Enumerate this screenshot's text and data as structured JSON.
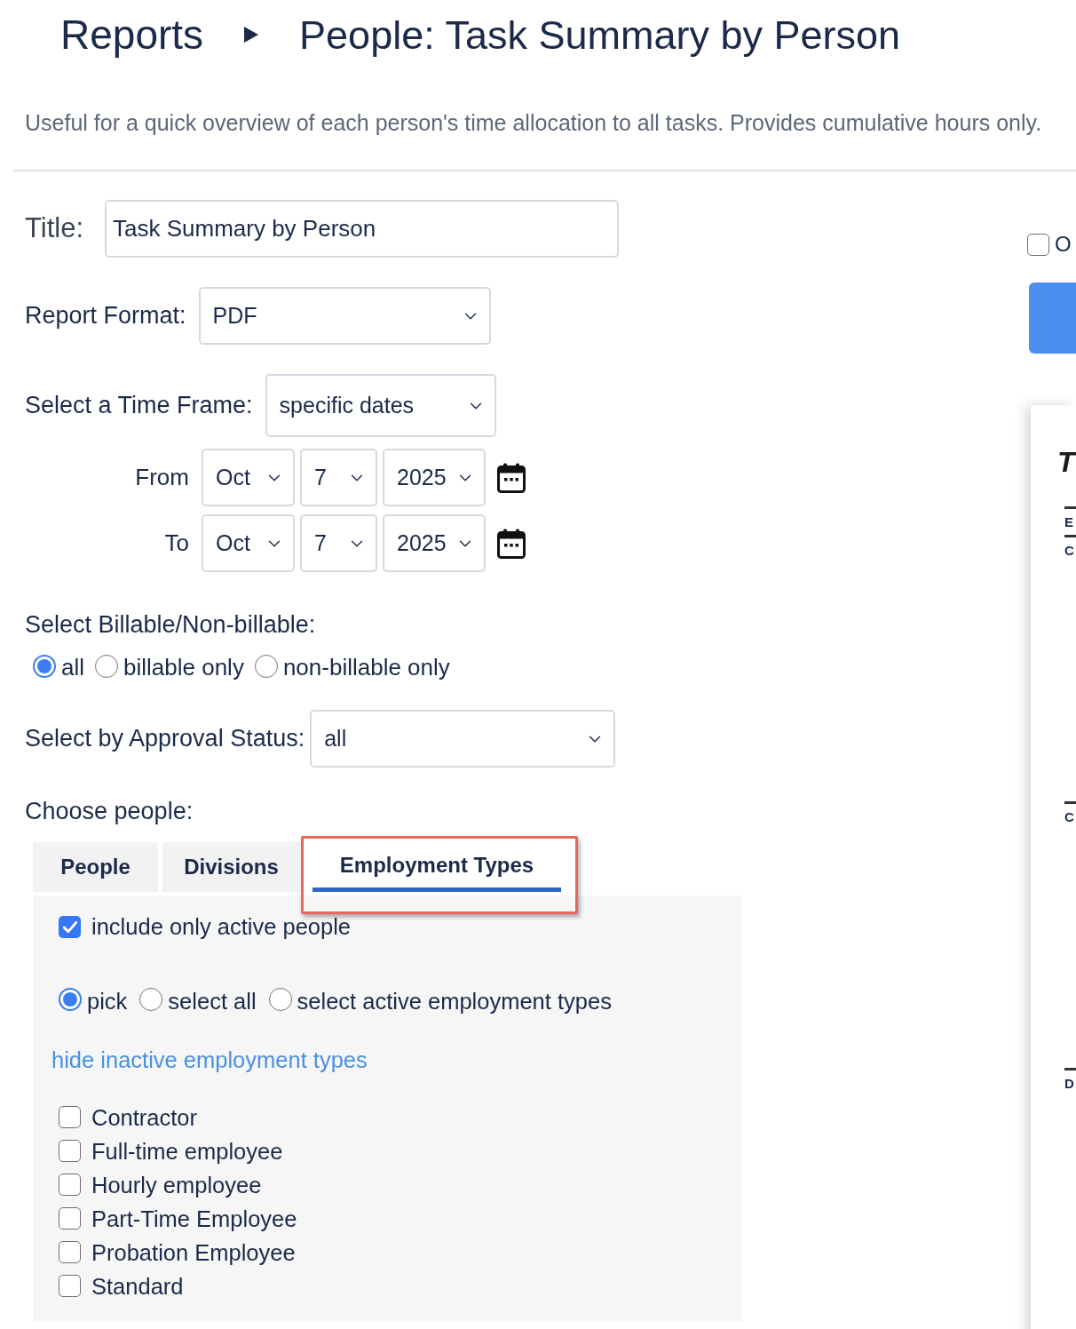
{
  "breadcrumb": {
    "items": [
      "Reports",
      "People: Task Summary by Person"
    ]
  },
  "description": "Useful for a quick overview of each person's time allocation to all tasks. Provides cumulative hours only.",
  "form": {
    "title": {
      "label": "Title:",
      "value": "Task Summary by Person"
    },
    "report_format": {
      "label": "Report Format:",
      "value": "PDF"
    },
    "time_frame": {
      "label": "Select a Time Frame:",
      "value": "specific dates"
    },
    "date_rows": [
      {
        "label": "From",
        "month": "Oct",
        "day": "7",
        "year": "2025"
      },
      {
        "label": "To",
        "month": "Oct",
        "day": "7",
        "year": "2025"
      }
    ],
    "billable": {
      "label": "Select Billable/Non-billable:",
      "options": [
        {
          "label": "all",
          "selected": true
        },
        {
          "label": "billable only",
          "selected": false
        },
        {
          "label": "non-billable only",
          "selected": false
        }
      ]
    },
    "approval": {
      "label": "Select by Approval Status:",
      "value": "all"
    },
    "people": {
      "label": "Choose people:",
      "tabs": [
        {
          "label": "People",
          "selected": false,
          "highlighted": false
        },
        {
          "label": "Divisions",
          "selected": false,
          "highlighted": false
        },
        {
          "label": "Employment Types",
          "selected": true,
          "highlighted": true
        }
      ],
      "active_only": {
        "label": "include only active people",
        "checked": true
      },
      "modes": [
        {
          "label": "pick",
          "selected": true
        },
        {
          "label": "select all",
          "selected": false
        },
        {
          "label": "select active employment types",
          "selected": false
        }
      ],
      "link": "hide inactive employment types",
      "items": [
        {
          "label": "Contractor",
          "checked": false
        },
        {
          "label": "Full-time employee",
          "checked": false
        },
        {
          "label": "Hourly employee",
          "checked": false
        },
        {
          "label": "Part-Time Employee",
          "checked": false
        },
        {
          "label": "Probation Employee",
          "checked": false
        },
        {
          "label": "Standard",
          "checked": false
        }
      ]
    }
  },
  "side": {
    "option": {
      "label": "O",
      "checked": false
    },
    "preview": {
      "title": "T",
      "sections": [
        {
          "lines": [
            "E",
            "C"
          ]
        },
        {
          "lines": [
            "C"
          ]
        },
        {
          "lines": [
            "D"
          ]
        }
      ]
    }
  }
}
